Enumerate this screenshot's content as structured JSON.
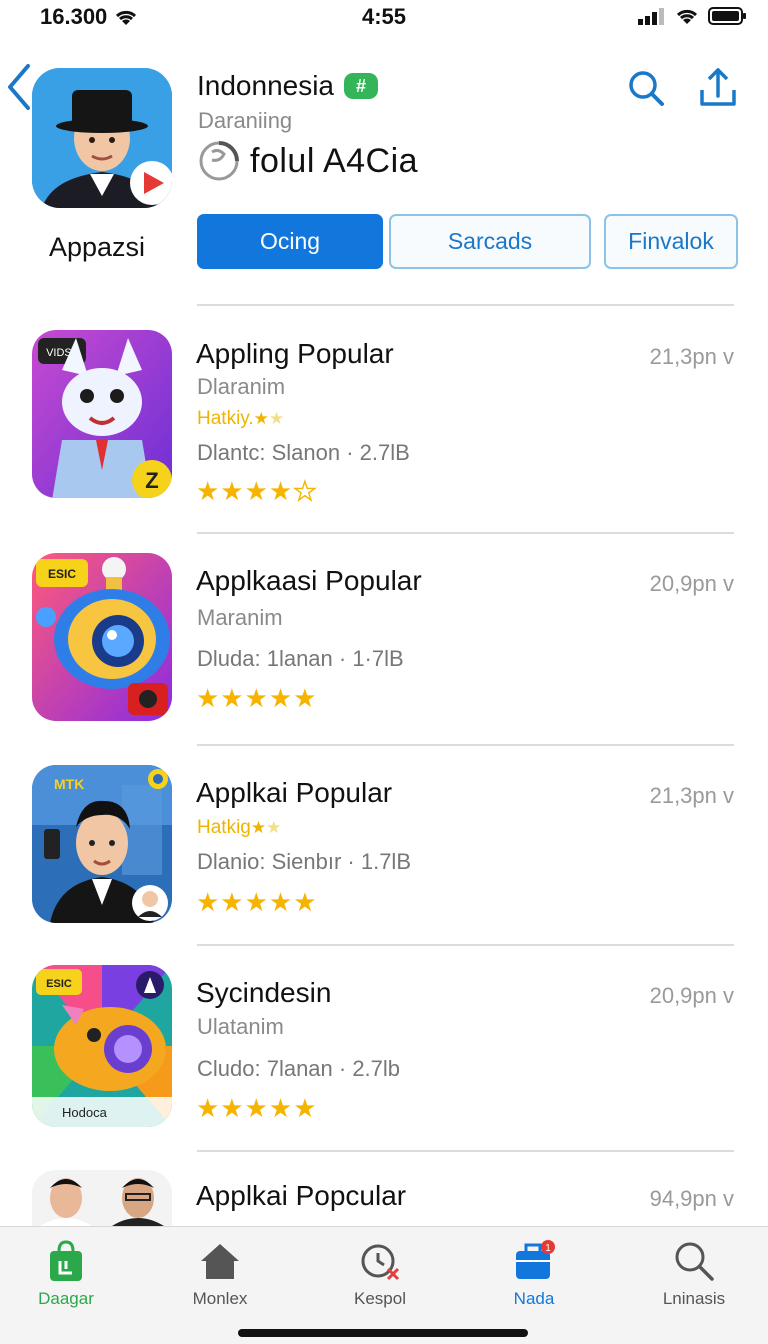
{
  "status_bar": {
    "left_text": "16.300",
    "time": "4:55"
  },
  "header": {
    "app_name": "Appazsi",
    "title": "Indonnesia",
    "badge": "#",
    "subtitle": "Daraniing",
    "loader_text": "folul A4Cia",
    "segments": [
      "Ocing",
      "Sarcads",
      "Finvalok"
    ]
  },
  "apps": [
    {
      "title": "Appling Popular",
      "size": "21,3pn v",
      "subtitle": "Dlaranim",
      "tag": "Hatkiy.",
      "meta": "Dlantc: Slanon · 2.7lB",
      "rating": 4
    },
    {
      "title": "Applkaasi Popular",
      "size": "20,9pn v",
      "subtitle": "Maranim",
      "tag": "",
      "meta": "Dluda: 1lanan · 1·7lB",
      "rating": 5
    },
    {
      "title": "Applkai Popular",
      "size": "21,3pn v",
      "subtitle": "",
      "tag": "Hatkig",
      "meta": "Dlanio: Sienbır · 1.7lB",
      "rating": 5
    },
    {
      "title": "Sycindesin",
      "size": "20,9pn v",
      "subtitle": "Ulatanim",
      "tag": "",
      "meta": "Cludo: 7lanan · 2.7lb",
      "rating": 5
    },
    {
      "title": "Applkai Popcular",
      "size": "94,9pn v",
      "subtitle": "",
      "tag": "",
      "meta": "",
      "rating": 0
    }
  ],
  "thumb_text": {
    "a1": "VIDSL",
    "a1_badge": "Z",
    "a2": "ESIC",
    "a3": "MTK",
    "a4": "ESIC",
    "a4_bottom": "Hodoca"
  },
  "tabs": [
    {
      "label": "Daagar",
      "icon": "store-bag-icon",
      "color": "#2aa84a"
    },
    {
      "label": "Monlex",
      "icon": "home-icon",
      "color": "#555555"
    },
    {
      "label": "Kespol",
      "icon": "refresh-clock-icon",
      "color": "#555555"
    },
    {
      "label": "Nada",
      "icon": "briefcase-icon",
      "color": "#1177dd",
      "badge": "1"
    },
    {
      "label": "Lninasis",
      "icon": "search-icon",
      "color": "#555555"
    }
  ],
  "colors": {
    "accent": "#1177dd",
    "star": "#f6b400",
    "badge_green": "#34b55a"
  }
}
